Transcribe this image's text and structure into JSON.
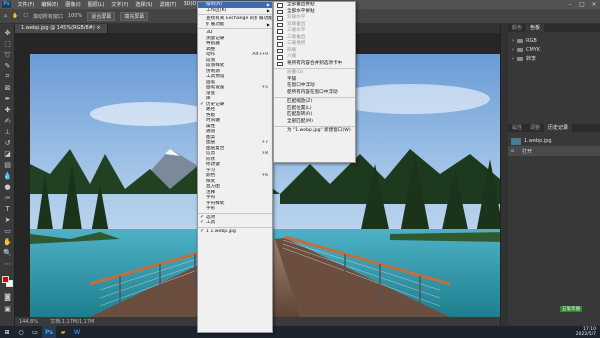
{
  "app": {
    "logo": "Ps",
    "min": "–",
    "max": "□",
    "close": "✕"
  },
  "menubar": [
    "文件(F)",
    "编辑(E)",
    "图像(I)",
    "图层(L)",
    "文字(Y)",
    "选择(S)",
    "滤镜(T)",
    "3D(D)",
    "视图(V)",
    "增效工具",
    "窗口(W)",
    "帮助(H)"
  ],
  "options": {
    "scroll_all": "滚动所有窗口",
    "zoom": "100%",
    "fit": "适合屏幕",
    "fill": "填充屏幕",
    "scroll_label": "细微缩放",
    "home_label": "适合屏幕"
  },
  "tabs": [
    "1.webp.jpg @ 145%(RGB/8#) ×"
  ],
  "status": {
    "zoom": "144.8%",
    "doc": "文档:1.17M/1.17M"
  },
  "window_menu": {
    "items": [
      {
        "label": "排列(A)",
        "arrow": true,
        "highlight": true
      },
      {
        "label": "工作区(K)",
        "arrow": true
      },
      {
        "sep": true
      },
      {
        "label": "查找有关 Exchange 的扩展功能..."
      },
      {
        "label": "扩展功能",
        "arrow": true
      },
      {
        "sep": true
      },
      {
        "label": "3D"
      },
      {
        "label": "测量记录"
      },
      {
        "label": "导航器"
      },
      {
        "label": "调整"
      },
      {
        "label": "动作",
        "shortcut": "Alt+F9"
      },
      {
        "label": "段落"
      },
      {
        "label": "段落样式"
      },
      {
        "label": "仿制源"
      },
      {
        "label": "工具预设"
      },
      {
        "label": "画笔"
      },
      {
        "label": "画笔设置",
        "shortcut": "F5"
      },
      {
        "label": "渐变"
      },
      {
        "label": "库"
      },
      {
        "label": "历史记录",
        "check": true
      },
      {
        "label": "路径"
      },
      {
        "label": "色板"
      },
      {
        "label": "时间轴"
      },
      {
        "label": "属性"
      },
      {
        "label": "通道"
      },
      {
        "label": "图案"
      },
      {
        "label": "图层",
        "shortcut": "F7"
      },
      {
        "label": "图层复合"
      },
      {
        "label": "信息",
        "shortcut": "F8"
      },
      {
        "label": "形状"
      },
      {
        "label": "修改键"
      },
      {
        "label": "学习"
      },
      {
        "label": "颜色",
        "shortcut": "F6"
      },
      {
        "label": "样式"
      },
      {
        "label": "直方图"
      },
      {
        "label": "注释"
      },
      {
        "label": "字符"
      },
      {
        "label": "字符样式"
      },
      {
        "label": "字形"
      },
      {
        "sep": true
      },
      {
        "label": "选项",
        "check": true
      },
      {
        "label": "工具",
        "check": true
      },
      {
        "sep": true
      },
      {
        "label": "1 1.webp.jpg",
        "check": true
      }
    ]
  },
  "arrange_menu": {
    "items": [
      {
        "label": "全部垂直拼贴"
      },
      {
        "label": "全部水平拼贴"
      },
      {
        "label": "双联水平",
        "dis": true
      },
      {
        "label": "双联垂直",
        "dis": true
      },
      {
        "label": "三联水平",
        "dis": true
      },
      {
        "label": "三联垂直",
        "dis": true
      },
      {
        "label": "三联堆积",
        "dis": true
      },
      {
        "label": "四联",
        "dis": true
      },
      {
        "label": "六联",
        "dis": true
      },
      {
        "label": "将所有内容合并到选项卡中"
      },
      {
        "sep": true
      },
      {
        "label": "层叠(D)",
        "dis": true,
        "noicon": true
      },
      {
        "label": "平铺",
        "noicon": true
      },
      {
        "label": "在窗口中浮动",
        "noicon": true
      },
      {
        "label": "使所有内容在窗口中浮动",
        "noicon": true
      },
      {
        "sep": true
      },
      {
        "label": "匹配缩放(Z)",
        "noicon": true
      },
      {
        "label": "匹配位置(L)",
        "noicon": true
      },
      {
        "label": "匹配旋转(R)",
        "noicon": true
      },
      {
        "label": "全部匹配(M)",
        "noicon": true
      },
      {
        "sep": true
      },
      {
        "label": "为 \"1.webp.jpg\" 新建窗口(W)",
        "noicon": true
      }
    ]
  },
  "right_panel": {
    "tabs1": [
      "颜色",
      "色板"
    ],
    "tabs2": [
      "图层",
      "通道",
      "路径"
    ],
    "channels": [
      "RGB",
      "CMYK",
      "转李"
    ],
    "tabs3": [
      "属性",
      "调整",
      "历史记录"
    ],
    "history_file": "1.webp.jpg",
    "history_step": "打开"
  },
  "taskbar": {
    "time": "17:10",
    "date": "2022/5/7",
    "badge": "五笔华丽"
  },
  "colors": {
    "accent": "#3d6bb0",
    "fg_swatch": "#e00000",
    "bg_swatch": "#ffffff"
  }
}
